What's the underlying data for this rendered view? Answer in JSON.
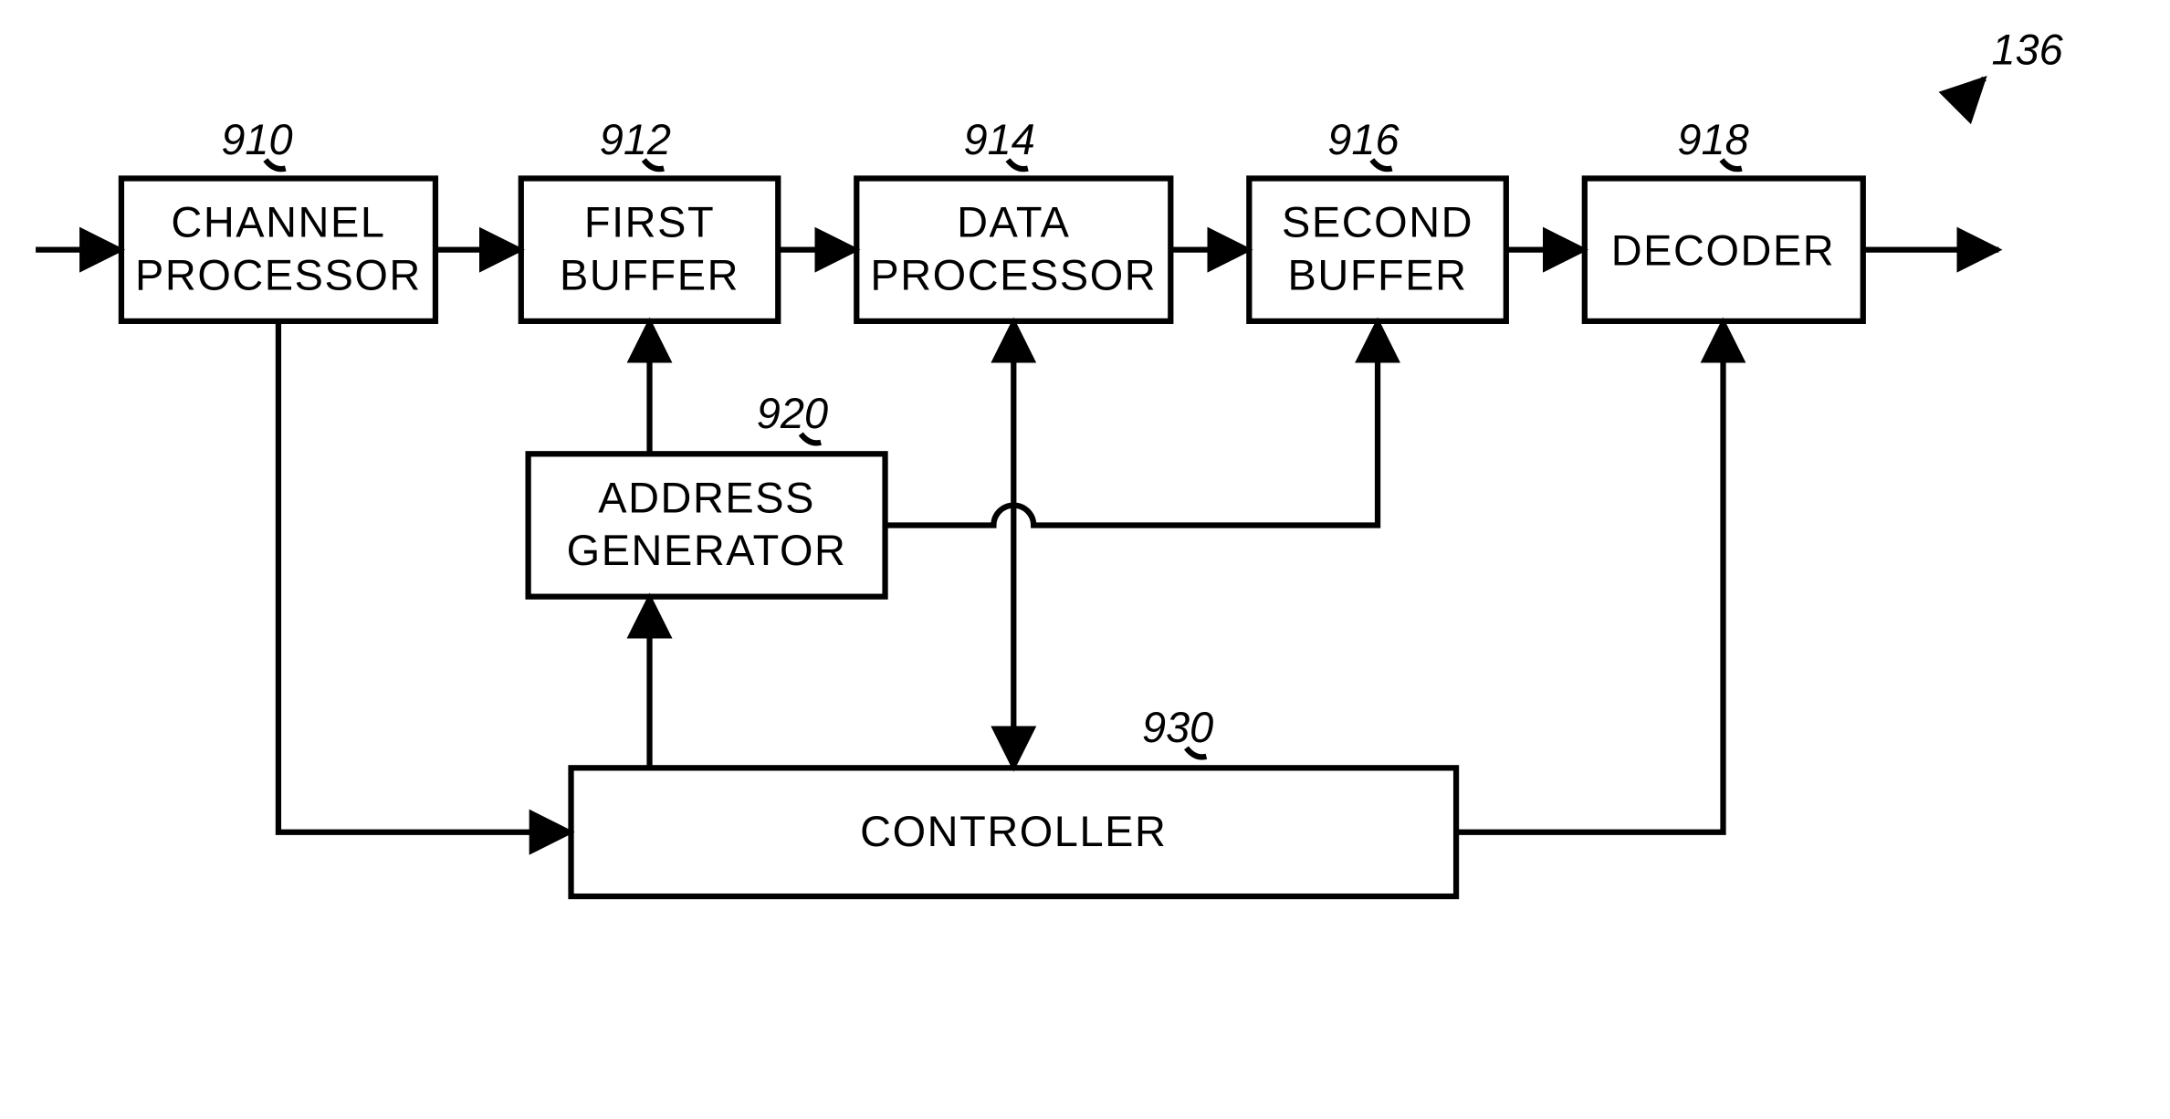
{
  "figure_ref": "136",
  "blocks": {
    "b910": {
      "ref": "910",
      "line1": "CHANNEL",
      "line2": "PROCESSOR"
    },
    "b912": {
      "ref": "912",
      "line1": "FIRST",
      "line2": "BUFFER"
    },
    "b914": {
      "ref": "914",
      "line1": "DATA",
      "line2": "PROCESSOR"
    },
    "b916": {
      "ref": "916",
      "line1": "SECOND",
      "line2": "BUFFER"
    },
    "b918": {
      "ref": "918",
      "line1": "DECODER",
      "line2": ""
    },
    "b920": {
      "ref": "920",
      "line1": "ADDRESS",
      "line2": "GENERATOR"
    },
    "b930": {
      "ref": "930",
      "line1": "CONTROLLER",
      "line2": ""
    }
  }
}
